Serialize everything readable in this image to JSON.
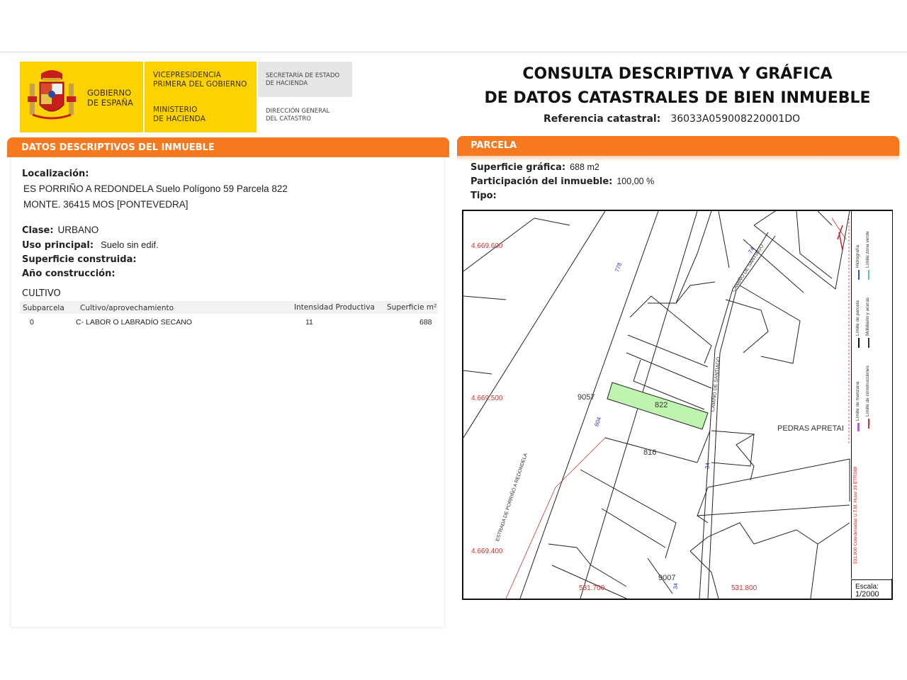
{
  "header": {
    "logo": {
      "gobierno": "GOBIERNO\nDE ESPAÑA",
      "vicepresidencia": "VICEPRESIDENCIA\nPRIMERA DEL GOBIERNO",
      "ministerio": "MINISTERIO\nDE HACIENDA",
      "secretaria": "SECRETARÍA DE ESTADO\nDE HACIENDA",
      "direccion": "DIRECCIÓN GENERAL\nDEL CATASTRO"
    },
    "title_line1": "CONSULTA DESCRIPTIVA Y GRÁFICA",
    "title_line2": "DE DATOS CATASTRALES DE BIEN INMUEBLE",
    "ref_label": "Referencia catastral:",
    "ref_value": "36033A059008220001DO"
  },
  "datos": {
    "section_title": "DATOS DESCRIPTIVOS DEL INMUEBLE",
    "localizacion_label": "Localización:",
    "localizacion_line1": "ES PORRIÑO A REDONDELA  Suelo Polígono 59 Parcela 822",
    "localizacion_line2": "MONTE. 36415 MOS [PONTEVEDRA]",
    "clase_label": "Clase:",
    "clase_value": "URBANO",
    "uso_label": "Uso principal:",
    "uso_value": "Suelo sin edif.",
    "superficie_construida_label": "Superficie construida:",
    "anio_label": "Año construcción:",
    "cultivo_title": "CULTIVO",
    "cultivo_headers": {
      "subparcela": "Subparcela",
      "cultivo": "Cultivo/aprovechamiento",
      "intensidad": "Intensidad Productiva",
      "superficie": "Superficie m²"
    },
    "cultivo_row": {
      "subparcela": "0",
      "cultivo": "C- LABOR O LABRADÍO  SECANO",
      "intensidad": "11",
      "superficie": "688"
    }
  },
  "parcela": {
    "section_title": "PARCELA",
    "superficie_label": "Superficie gráfica:",
    "superficie_value": "688 m2",
    "participacion_label": "Participación del inmueble:",
    "participacion_value": "100,00 %",
    "tipo_label": "Tipo:"
  },
  "map": {
    "y_labels": [
      "4.669.600",
      "4.669.500",
      "4.669.400"
    ],
    "x_labels": [
      "531.700",
      "531.800"
    ],
    "parcels": [
      "9057",
      "822",
      "816",
      "9007"
    ],
    "parcel_822_highlight": "#bff3b0",
    "place_name": "PEDRAS APRETAI",
    "road_1": "ESTRADA DE PORRIÑO A REDONDELA",
    "road_2": "CAMIÑO DE SANTIAGO",
    "road_3": "CAMIÑO DE SANTIAGO",
    "numbers_blue": [
      "778",
      "604",
      "74",
      "34",
      "34"
    ],
    "legend": {
      "limite_manzana": "Límite de manzana",
      "limite_parcela": "Límite de parcela",
      "hidrografia": "Hidrografía",
      "limite_construcciones": "Límite de construcciones",
      "mobiliario": "Mobiliario y aceras",
      "zona_verde": "Límite zona verde",
      "coords": "531,900 Coordenadas U.T.M. Huso 29 ETRS89"
    },
    "scale_label": "Escala:",
    "scale_value": "1/2000"
  }
}
